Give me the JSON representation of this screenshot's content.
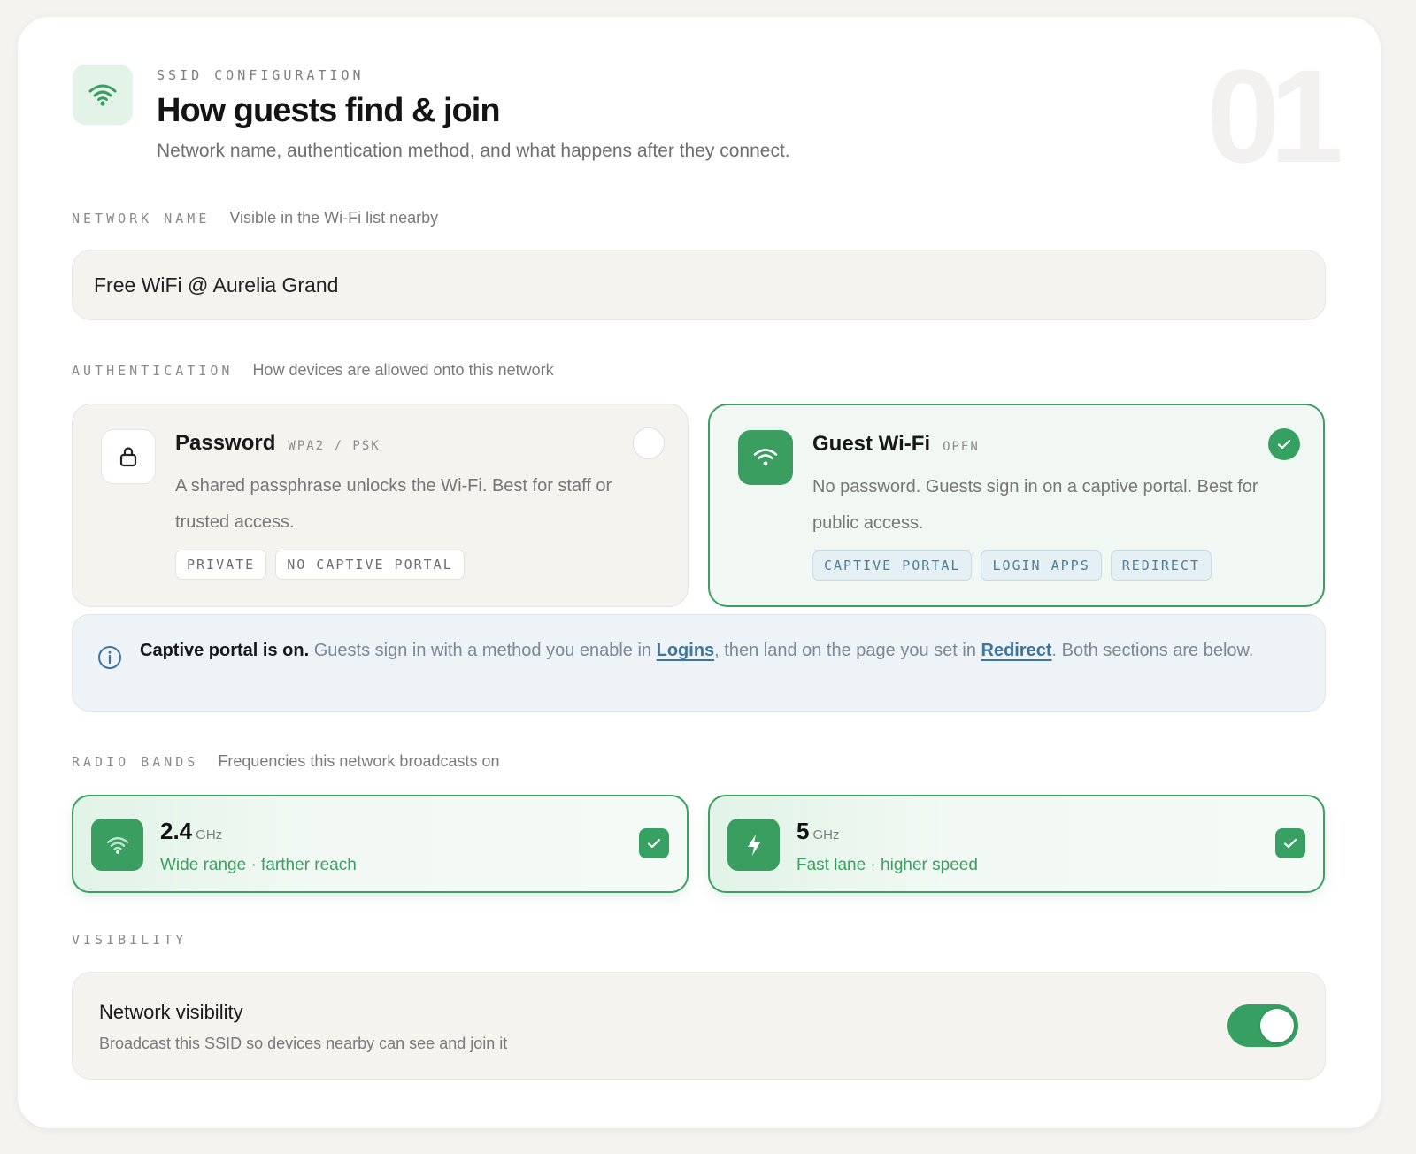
{
  "header": {
    "eyebrow": "SSID CONFIGURATION",
    "title": "How guests find & join",
    "subtitle": "Network name, authentication method, and what happens after they connect.",
    "step_number": "01"
  },
  "network_name": {
    "label": "NETWORK NAME",
    "hint": "Visible in the Wi-Fi list nearby",
    "value": "Free WiFi @ Aurelia Grand"
  },
  "authentication": {
    "label": "AUTHENTICATION",
    "hint": "How devices are allowed onto this network",
    "options": [
      {
        "title": "Password",
        "badge": "WPA2 / PSK",
        "description": "A shared passphrase unlocks the Wi-Fi. Best for staff or trusted access.",
        "tags": [
          "PRIVATE",
          "NO CAPTIVE PORTAL"
        ],
        "selected": false,
        "icon": "lock-icon"
      },
      {
        "title": "Guest Wi-Fi",
        "badge": "OPEN",
        "description": "No password. Guests sign in on a captive portal. Best for public access.",
        "tags": [
          "CAPTIVE PORTAL",
          "LOGIN APPS",
          "REDIRECT"
        ],
        "selected": true,
        "icon": "wifi-icon"
      }
    ]
  },
  "info_banner": {
    "lead": "Captive portal is on.",
    "text1": " Guests sign in with a method you enable in ",
    "link1": "Logins",
    "text2": ", then land on the page you set in ",
    "link2": "Redirect",
    "text3": ". Both sections are below."
  },
  "radio_bands": {
    "label": "RADIO BANDS",
    "hint": "Frequencies this network broadcasts on",
    "bands": [
      {
        "value": "2.4",
        "unit": "GHz",
        "subtitle": "Wide range · farther reach",
        "checked": true,
        "icon": "wifi-icon"
      },
      {
        "value": "5",
        "unit": "GHz",
        "subtitle": "Fast lane · higher speed",
        "checked": true,
        "icon": "bolt-icon"
      }
    ]
  },
  "visibility": {
    "label": "VISIBILITY",
    "title": "Network visibility",
    "subtitle": "Broadcast this SSID so devices nearby can see and join it",
    "enabled": true
  },
  "colors": {
    "accent_green": "#3a9e60",
    "link_blue": "#3d74a0",
    "page_bg": "#f4f3f0"
  }
}
